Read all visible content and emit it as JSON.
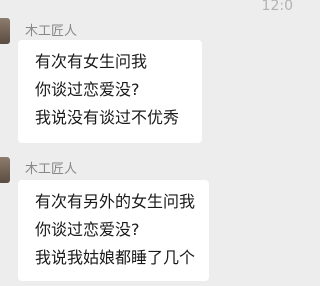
{
  "header": {
    "timestamp": "12:0"
  },
  "messages": [
    {
      "sender": "木工匠人",
      "lines": [
        "有次有女生问我",
        "你谈过恋爱没?",
        "我说没有谈过不优秀"
      ]
    },
    {
      "sender": "木工匠人",
      "lines": [
        "有次有另外的女生问我",
        "你谈过恋爱没?",
        "我说我姑娘都睡了几个"
      ]
    }
  ]
}
